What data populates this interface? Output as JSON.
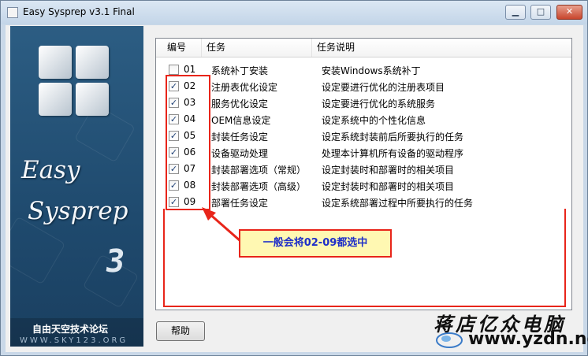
{
  "window": {
    "title": "Easy Sysprep v3.1 Final",
    "min_icon": "minimize-icon",
    "max_icon": "maximize-icon",
    "close_icon": "close-icon"
  },
  "sidebar": {
    "brand_line1": "Easy",
    "brand_line2": "Sysprep",
    "brand_version": "3",
    "site_name": "自由天空技术论坛",
    "site_url": "WWW.SKY123.ORG"
  },
  "list": {
    "columns": [
      "编号",
      "任务",
      "任务说明"
    ],
    "rows": [
      {
        "checked": false,
        "num": "01",
        "task": "系统补丁安装",
        "desc": "安装Windows系统补丁"
      },
      {
        "checked": true,
        "num": "02",
        "task": "注册表优化设定",
        "desc": "设定要进行优化的注册表项目"
      },
      {
        "checked": true,
        "num": "03",
        "task": "服务优化设定",
        "desc": "设定要进行优化的系统服务"
      },
      {
        "checked": true,
        "num": "04",
        "task": "OEM信息设定",
        "desc": "设定系统中的个性化信息"
      },
      {
        "checked": true,
        "num": "05",
        "task": "封装任务设定",
        "desc": "设定系统封装前后所要执行的任务"
      },
      {
        "checked": true,
        "num": "06",
        "task": "设备驱动处理",
        "desc": "处理本计算机所有设备的驱动程序"
      },
      {
        "checked": true,
        "num": "07",
        "task": "封装部署选项（常规）",
        "desc": "设定封装时和部署时的相关项目"
      },
      {
        "checked": true,
        "num": "08",
        "task": "封装部署选项（高级）",
        "desc": "设定封装时和部署时的相关项目"
      },
      {
        "checked": true,
        "num": "09",
        "task": "部署任务设定",
        "desc": "设定系统部署过程中所要执行的任务"
      }
    ]
  },
  "annotation": {
    "callout_text": "一般会将02-09都选中"
  },
  "buttons": {
    "help_label": "帮助"
  },
  "watermark": {
    "cn": "蒋店亿众电脑",
    "url": "www.yzdn.net"
  },
  "colors": {
    "accent_red": "#e8251a",
    "sidebar_blue": "#1f4a6e",
    "callout_bg": "#fff8b2",
    "callout_text": "#1e2ec8"
  }
}
